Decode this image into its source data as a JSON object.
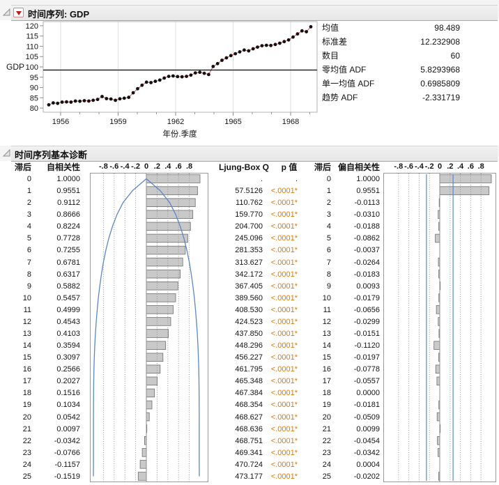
{
  "icons": {
    "panel_disclosure": "disclosure-open-icon",
    "panel_menu": "red-triangle-menu-icon"
  },
  "panel1": {
    "title": "时间序列: GDP",
    "stats": [
      {
        "label": "均值",
        "value": "98.489"
      },
      {
        "label": "标准差",
        "value": "12.232908"
      },
      {
        "label": "数目",
        "value": "60"
      },
      {
        "label": "零均值 ADF",
        "value": "5.8293968"
      },
      {
        "label": "单一均值 ADF",
        "value": "0.6985809"
      },
      {
        "label": "趋势 ADF",
        "value": "-2.331719"
      }
    ]
  },
  "panel2": {
    "title": "时间序列基本诊断",
    "headers": {
      "lag": "滞后",
      "acf": "自相关性",
      "ljung": "Ljung-Box Q",
      "pval": "p 值",
      "lag2": "滞后",
      "pacf": "偏自相关性"
    },
    "rows": {
      "lag": [
        "0",
        "1",
        "2",
        "3",
        "4",
        "5",
        "6",
        "7",
        "8",
        "9",
        "10",
        "11",
        "12",
        "13",
        "14",
        "15",
        "16",
        "17",
        "18",
        "19",
        "20",
        "21",
        "22",
        "23",
        "24",
        "25"
      ],
      "acf": [
        "1.0000",
        "0.9551",
        "0.9112",
        "0.8666",
        "0.8224",
        "0.7728",
        "0.7255",
        "0.6781",
        "0.6317",
        "0.5882",
        "0.5457",
        "0.4999",
        "0.4543",
        "0.4103",
        "0.3594",
        "0.3097",
        "0.2566",
        "0.2027",
        "0.1516",
        "0.1034",
        "0.0542",
        "0.0097",
        "-0.0342",
        "-0.0766",
        "-0.1157",
        "-0.1519"
      ],
      "q": [
        ".",
        "57.5126",
        "110.762",
        "159.770",
        "204.700",
        "245.096",
        "281.353",
        "313.627",
        "342.172",
        "367.405",
        "389.560",
        "408.530",
        "424.523",
        "437.850",
        "448.296",
        "456.227",
        "461.795",
        "465.348",
        "467.384",
        "468.354",
        "468.627",
        "468.636",
        "468.751",
        "469.341",
        "470.724",
        "473.177"
      ],
      "p": [
        ".",
        "<.0001*",
        "<.0001*",
        "<.0001*",
        "<.0001*",
        "<.0001*",
        "<.0001*",
        "<.0001*",
        "<.0001*",
        "<.0001*",
        "<.0001*",
        "<.0001*",
        "<.0001*",
        "<.0001*",
        "<.0001*",
        "<.0001*",
        "<.0001*",
        "<.0001*",
        "<.0001*",
        "<.0001*",
        "<.0001*",
        "<.0001*",
        "<.0001*",
        "<.0001*",
        "<.0001*",
        "<.0001*"
      ],
      "pacf": [
        "1.0000",
        "0.9551",
        "-0.0113",
        "-0.0310",
        "-0.0188",
        "-0.0862",
        "-0.0037",
        "-0.0264",
        "-0.0183",
        "0.0093",
        "-0.0179",
        "-0.0656",
        "-0.0299",
        "-0.0151",
        "-0.1120",
        "-0.0197",
        "-0.0778",
        "-0.0557",
        "0.0000",
        "-0.0181",
        "-0.0509",
        "0.0099",
        "-0.0454",
        "-0.0342",
        "0.0004",
        "-0.0202"
      ]
    }
  },
  "colors": {
    "accent_blue": "#5b87c5",
    "sig_orange": "#e07800",
    "bar_fill": "#c9c9c9",
    "bar_stroke": "#6f6f6f",
    "series_line": "#d85050",
    "marker": "#111111"
  },
  "chart_data": [
    {
      "type": "line",
      "title": "时间序列: GDP",
      "xlabel": "年份.季度",
      "ylabel": "GDP",
      "ylim": [
        80,
        120
      ],
      "yticks": [
        80,
        85,
        90,
        95,
        100,
        105,
        110,
        115,
        120
      ],
      "xticks": [
        1956,
        1959,
        1962,
        1965,
        1968
      ],
      "x_start": 1955.25,
      "x_step": 0.25,
      "mean_line": 98.489,
      "n": 60,
      "values": [
        81.6,
        82.5,
        82.3,
        82.9,
        83.0,
        82.9,
        83.4,
        83.3,
        83.6,
        83.4,
        83.8,
        84.2,
        85.6,
        84.6,
        84.4,
        83.8,
        84.5,
        84.8,
        85.2,
        87.4,
        89.4,
        91.1,
        92.6,
        92.4,
        93.0,
        93.6,
        94.6,
        95.4,
        95.6,
        95.3,
        95.2,
        95.4,
        96.0,
        97.1,
        97.4,
        96.9,
        96.3,
        100.2,
        101.6,
        103.2,
        104.4,
        105.5,
        106.4,
        107.3,
        108.2,
        107.8,
        108.8,
        109.6,
        110.3,
        110.5,
        110.4,
        110.9,
        111.5,
        112.3,
        113.1,
        114.5,
        116.0,
        117.5,
        117.1,
        119.5
      ]
    },
    {
      "type": "bar",
      "name": "自相关性",
      "orientation": "horizontal",
      "categories": [
        0,
        1,
        2,
        3,
        4,
        5,
        6,
        7,
        8,
        9,
        10,
        11,
        12,
        13,
        14,
        15,
        16,
        17,
        18,
        19,
        20,
        21,
        22,
        23,
        24,
        25
      ],
      "values": [
        1.0,
        0.9551,
        0.9112,
        0.8666,
        0.8224,
        0.7728,
        0.7255,
        0.6781,
        0.6317,
        0.5882,
        0.5457,
        0.4999,
        0.4543,
        0.4103,
        0.3594,
        0.3097,
        0.2566,
        0.2027,
        0.1516,
        0.1034,
        0.0542,
        0.0097,
        -0.0342,
        -0.0766,
        -0.1157,
        -0.1519
      ],
      "xlim": [
        -1,
        1
      ],
      "tick_values": [
        -0.8,
        -0.6,
        -0.4,
        -0.2,
        0,
        0.2,
        0.4,
        0.6,
        0.8
      ],
      "tick_labels": [
        "-.8",
        "-.6",
        "-.4",
        "-.2",
        "0",
        ".2",
        ".4",
        ".6",
        ".8"
      ],
      "confidence": "bartlett-curve",
      "n": 60
    },
    {
      "type": "bar",
      "name": "偏自相关性",
      "orientation": "horizontal",
      "categories": [
        0,
        1,
        2,
        3,
        4,
        5,
        6,
        7,
        8,
        9,
        10,
        11,
        12,
        13,
        14,
        15,
        16,
        17,
        18,
        19,
        20,
        21,
        22,
        23,
        24,
        25
      ],
      "values": [
        1.0,
        0.9551,
        -0.0113,
        -0.031,
        -0.0188,
        -0.0862,
        -0.0037,
        -0.0264,
        -0.0183,
        0.0093,
        -0.0179,
        -0.0656,
        -0.0299,
        -0.0151,
        -0.112,
        -0.0197,
        -0.0778,
        -0.0557,
        0.0,
        -0.0181,
        -0.0509,
        0.0099,
        -0.0454,
        -0.0342,
        0.0004,
        -0.0202
      ],
      "xlim": [
        -1,
        1
      ],
      "tick_values": [
        -0.8,
        -0.6,
        -0.4,
        -0.2,
        0,
        0.2,
        0.4,
        0.6,
        0.8
      ],
      "tick_labels": [
        "-.8",
        "-.6",
        "-.4",
        "-.2",
        "0",
        ".2",
        ".4",
        ".6",
        ".8"
      ],
      "confidence": "fixed-lines",
      "conf_limit": 0.2582,
      "n": 60
    }
  ]
}
